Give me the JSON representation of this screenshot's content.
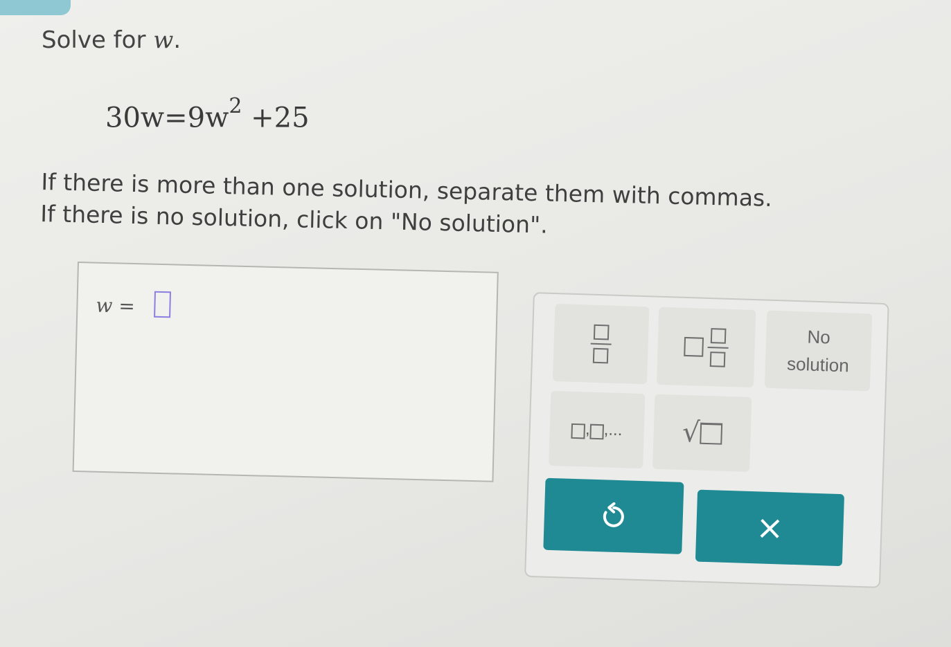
{
  "problem": {
    "prompt_text": "Solve for ",
    "prompt_var": "w",
    "prompt_end": ".",
    "equation": {
      "lhs": "30w",
      "equals": "=",
      "rhs_coef": "9w",
      "rhs_exp": "2",
      "rhs_rest": "+25"
    },
    "instruction_line1": "If there is more than one solution, separate them with commas.",
    "instruction_line2": "If there is no solution, click on \"No solution\"."
  },
  "answer": {
    "var": "w",
    "equals": "=",
    "value": ""
  },
  "keypad": {
    "no_solution_line1": "No",
    "no_solution_line2": "solution",
    "list_suffix": ",...",
    "list_comma": ",",
    "sqrt_symbol": "√",
    "clear_symbol": "×"
  },
  "colors": {
    "accent_teal": "#1f8a94",
    "input_border": "#8a7ee0",
    "tab": "#8fc7d3"
  }
}
